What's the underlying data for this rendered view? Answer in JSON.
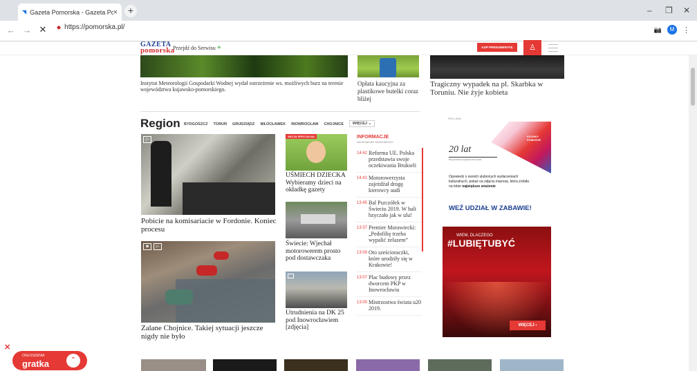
{
  "browser": {
    "tab_title": "Gazeta Pomorska - Gazeta Pomo",
    "tab_close": "×",
    "new_tab": "+",
    "url": "https://pomorska.pl/",
    "profile_initial": "M",
    "min": "–",
    "max": "❐",
    "close": "✕",
    "back": "←",
    "forward": "→",
    "stop": "✕",
    "camera": "📷",
    "menu": "⋮"
  },
  "header": {
    "logo_line1": "GAZETA",
    "logo_line2": "pomorska",
    "service_label": "Przejdź do Serwisu",
    "service_plus": "+",
    "subscribe_label": "KUP PRENUMERATĘ",
    "user_icon": "♙"
  },
  "top_row": [
    {
      "caption": "Instytut Meteorologii Gospodarki Wodnej wydał ostrzeżenie ws. możliwych burz na terenie województwa kujawsko-pomorskiego."
    },
    {
      "caption": "Opłata kaucyjna za plastikowe butelki coraz bliżej"
    },
    {
      "caption": "Tragiczny wypadek na pl. Skarbka w Toruniu. Nie żyje kobieta"
    }
  ],
  "region": {
    "title": "Region",
    "links": [
      "BYDGOSZCZ",
      "TORUŃ",
      "GRUDZIĄDZ",
      "WŁOCŁAWEK",
      "INOWROCŁAW",
      "CHOJNICE"
    ],
    "more": "WIĘCEJ ⌄",
    "main1": "Pobicie na komisariacie w Fordonie. Koniec procesu",
    "main2": "Zalane Chojnice. Takiej sytuacji jeszcze nigdy nie było",
    "side_badge": "AKCJA SPECJALNA",
    "side1": "UŚMIECH DZIECKA Wybieramy dzieci na okładkę gazety",
    "side2": "Świecie: Wjechał motorowerem prosto pod dostawczaka",
    "side3": "Utrudnienia na DK 25 pod Inowrocławiem [zdjęcia]"
  },
  "informacje": {
    "title": "INFORMACJE",
    "subtitle": "NAJNOWSZE WIADOMOŚCI",
    "items": [
      {
        "time": "14:42",
        "text": "Reforma UE. Polska przedstawia swoje oczekiwania Brukseli"
      },
      {
        "time": "14:41",
        "text": "Motorowerzysta zajeżdżał drogę kierowcy audi"
      },
      {
        "time": "13:45",
        "text": "Bal Pszczółek w Świeciu 2019. W hali bzyczało jak w ulu!"
      },
      {
        "time": "13:37",
        "text": "Premier Morawiecki: „Pedofilię trzeba wypalić żelazem”"
      },
      {
        "time": "13:09",
        "text": "Oto sześcioraczki, które urodziły się w Krakowie!"
      },
      {
        "time": "13:07",
        "text": "Plac budowy przez dworcem PKP w Inowrocławiu"
      },
      {
        "time": "13:00",
        "text": "Mistrzostwa świata u20 2019."
      }
    ]
  },
  "ad": {
    "label": "REKLAMA",
    "brand": "KUJAWY POMORZE",
    "years": "20 lat",
    "years_sub": "Województwo Kujawsko-Pomorskie",
    "body": "Opowiedz o swoich ulubionych wydarzeniach kulturalnych, pokaż na zdjęciu imprezę, która zrobiła na tobie",
    "body_bold": "największe wrażenie",
    "cta": "WEŹ UDZIAŁ W ZABAWIE!",
    "tag_small": "WIEM, DLACZEGO",
    "tag_big": "#LUBIĘTUBYĆ",
    "more": "WIĘCEJ  ›"
  },
  "gratka": {
    "small": "OGŁOSZENIA",
    "big": "gratka",
    "arrow": "⌃",
    "close": "✕"
  },
  "colors": {
    "brand_red": "#e53935",
    "brand_blue": "#1b3f8f"
  }
}
